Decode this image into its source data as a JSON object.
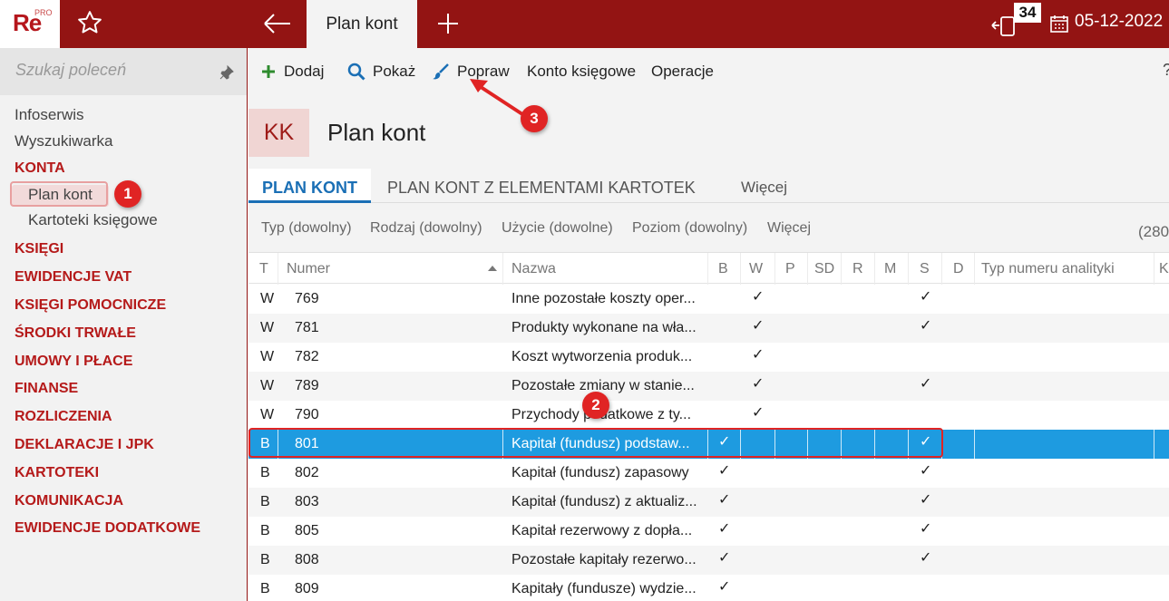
{
  "app": {
    "logo": "Re",
    "logo_badge": "PRO"
  },
  "header": {
    "active_tab": "Plan kont",
    "notifications_count": "34",
    "date": "05-12-2022"
  },
  "sidebar": {
    "search_placeholder": "Szukaj poleceń",
    "items": [
      {
        "label": "Infoserwis",
        "kind": "plain"
      },
      {
        "label": "Wyszukiwarka",
        "kind": "plain"
      },
      {
        "label": "KONTA",
        "kind": "section"
      },
      {
        "label": "Plan kont",
        "kind": "sub",
        "active": true
      },
      {
        "label": "Kartoteki księgowe",
        "kind": "sub"
      },
      {
        "label": "KSIĘGI",
        "kind": "section"
      },
      {
        "label": "EWIDENCJE VAT",
        "kind": "section"
      },
      {
        "label": "KSIĘGI POMOCNICZE",
        "kind": "section"
      },
      {
        "label": "ŚRODKI TRWAŁE",
        "kind": "section"
      },
      {
        "label": "UMOWY I PŁACE",
        "kind": "section"
      },
      {
        "label": "FINANSE",
        "kind": "section"
      },
      {
        "label": "ROZLICZENIA",
        "kind": "section"
      },
      {
        "label": "DEKLARACJE I JPK",
        "kind": "section"
      },
      {
        "label": "KARTOTEKI",
        "kind": "section"
      },
      {
        "label": "KOMUNIKACJA",
        "kind": "section"
      },
      {
        "label": "EWIDENCJE DODATKOWE",
        "kind": "section"
      }
    ]
  },
  "toolbar": {
    "add": "Dodaj",
    "show": "Pokaż",
    "edit": "Popraw",
    "account": "Konto księgowe",
    "operations": "Operacje",
    "help": "?"
  },
  "page": {
    "badge": "KK",
    "title": "Plan kont"
  },
  "tabs": [
    "PLAN KONT",
    "PLAN KONT Z ELEMENTAMI KARTOTEK",
    "Więcej"
  ],
  "filters": [
    "Typ (dowolny)",
    "Rodzaj (dowolny)",
    "Użycie (dowolne)",
    "Poziom (dowolny)",
    "Więcej"
  ],
  "record_count": "(280",
  "table": {
    "columns": [
      "T",
      "Numer",
      "Nazwa",
      "B",
      "W",
      "P",
      "SD",
      "R",
      "M",
      "S",
      "D",
      "Typ numeru analityki",
      "K"
    ],
    "rows": [
      {
        "t": "W",
        "numer": "769",
        "nazwa": "Inne pozostałe koszty oper...",
        "b": "",
        "w": "✓",
        "s": "✓"
      },
      {
        "t": "W",
        "numer": "781",
        "nazwa": "Produkty wykonane na wła...",
        "b": "",
        "w": "✓",
        "s": "✓"
      },
      {
        "t": "W",
        "numer": "782",
        "nazwa": "Koszt wytworzenia produk...",
        "b": "",
        "w": "✓",
        "s": ""
      },
      {
        "t": "W",
        "numer": "789",
        "nazwa": "Pozostałe zmiany w stanie...",
        "b": "",
        "w": "✓",
        "s": "✓"
      },
      {
        "t": "W",
        "numer": "790",
        "nazwa": "Przychody podatkowe z ty...",
        "b": "",
        "w": "✓",
        "s": ""
      },
      {
        "t": "B",
        "numer": "801",
        "nazwa": "Kapitał (fundusz) podstaw...",
        "b": "✓",
        "w": "",
        "s": "✓",
        "selected": true
      },
      {
        "t": "B",
        "numer": "802",
        "nazwa": "Kapitał (fundusz) zapasowy",
        "b": "✓",
        "w": "",
        "s": "✓"
      },
      {
        "t": "B",
        "numer": "803",
        "nazwa": "Kapitał (fundusz) z aktualiz...",
        "b": "✓",
        "w": "",
        "s": "✓"
      },
      {
        "t": "B",
        "numer": "805",
        "nazwa": "Kapitał rezerwowy z dopła...",
        "b": "✓",
        "w": "",
        "s": "✓"
      },
      {
        "t": "B",
        "numer": "808",
        "nazwa": "Pozostałe kapitały rezerwo...",
        "b": "✓",
        "w": "",
        "s": "✓"
      },
      {
        "t": "B",
        "numer": "809",
        "nazwa": "Kapitały (fundusze) wydzie...",
        "b": "✓",
        "w": "",
        "s": ""
      }
    ]
  },
  "annotations": [
    "1",
    "2",
    "3"
  ],
  "colors": {
    "brand": "#931413",
    "accent": "#1a6fb5",
    "selection": "#1e9be0",
    "annotation": "#e02424"
  }
}
